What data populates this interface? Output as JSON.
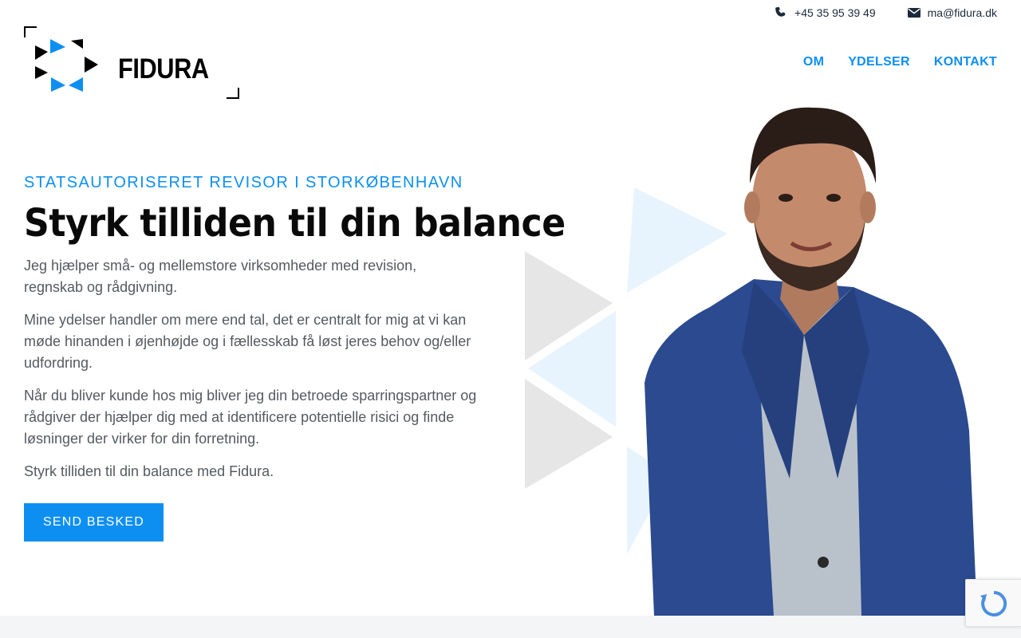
{
  "contact": {
    "phone": "+45 35 95 39 49",
    "email": "ma@fidura.dk",
    "phone_icon": "phone-icon",
    "email_icon": "envelope-icon"
  },
  "brand": {
    "name": "FIDURA",
    "logo_icon": "fidura-triangles-logo"
  },
  "nav": {
    "items": [
      {
        "label": "OM"
      },
      {
        "label": "YDELSER"
      },
      {
        "label": "KONTAKT"
      }
    ]
  },
  "hero": {
    "eyebrow": "STATSAUTORISERET REVISOR I STORKØBENHAVN",
    "headline": "Styrk tilliden til din balance",
    "paragraphs": [
      "Jeg hjælper små- og mellemstore virksomheder med revision, regnskab og rådgivning.",
      "Mine ydelser handler om mere end tal, det er centralt for mig at vi kan møde hinanden i øjenhøjde og i fællesskab få løst jeres behov og/eller udfordring.",
      "Når du bliver kunde hos mig bliver jeg din betroede sparringspartner og rådgiver der hjælper dig med at identificere potentielle risici og finde løsninger der virker for din forretning.",
      "Styrk tilliden til din balance med Fidura."
    ],
    "cta_label": "SEND BESKED"
  },
  "colors": {
    "accent": "#0d8ff2",
    "heading": "#0a0a0a",
    "body_text": "#555a60",
    "contact_text": "#1b2a3a",
    "footer_strip": "#f4f5f7"
  }
}
